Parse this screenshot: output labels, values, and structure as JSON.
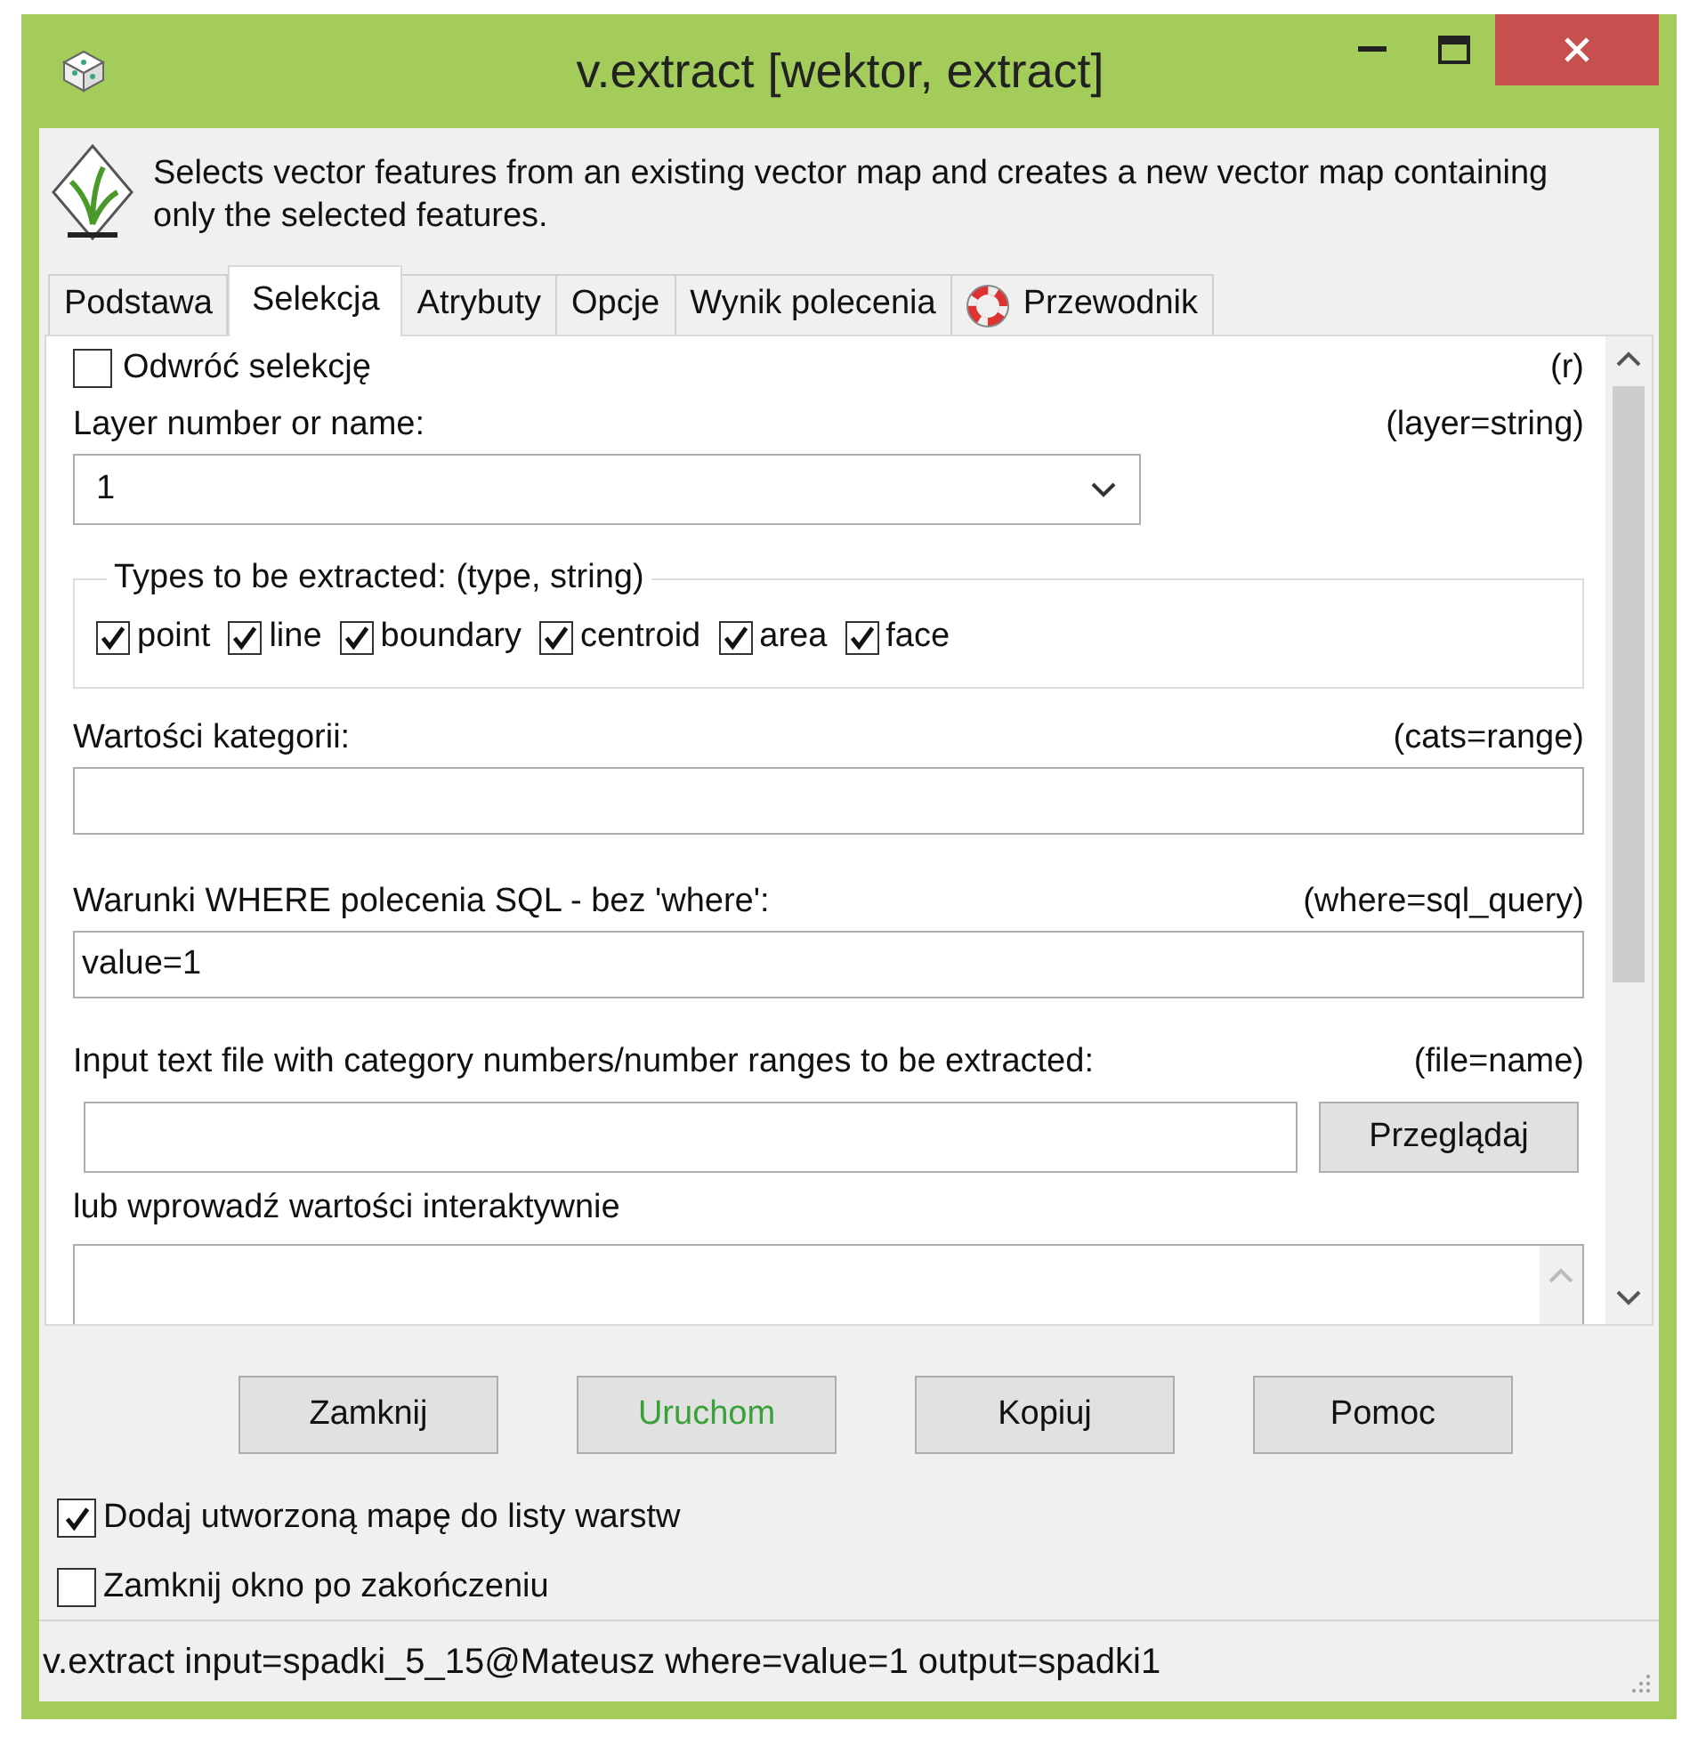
{
  "window": {
    "title": "v.extract [wektor, extract]"
  },
  "description": "Selects vector features from an existing vector map and creates a new vector map containing only the selected features.",
  "tabs": [
    {
      "label": "Podstawa",
      "selected": false,
      "kind": "plain"
    },
    {
      "label": "Selekcja",
      "selected": true,
      "kind": "plain"
    },
    {
      "label": "Atrybuty",
      "selected": false,
      "kind": "plain"
    },
    {
      "label": "Opcje",
      "selected": false,
      "kind": "plain"
    },
    {
      "label": "Wynik polecenia",
      "selected": false,
      "kind": "plain"
    },
    {
      "label": "Przewodnik",
      "selected": false,
      "kind": "help"
    }
  ],
  "panel": {
    "items": [
      {
        "kind": "checkbox",
        "label": "Odwróć selekcję",
        "param": "(r)",
        "checked": false
      },
      {
        "kind": "combo",
        "label": "Layer number or name:",
        "param": "(layer=string)",
        "value": "1"
      },
      {
        "kind": "group",
        "label": "Types to be extracted: (type, string)",
        "options": [
          {
            "label": "point",
            "checked": true
          },
          {
            "label": "line",
            "checked": true
          },
          {
            "label": "boundary",
            "checked": true
          },
          {
            "label": "centroid",
            "checked": true
          },
          {
            "label": "area",
            "checked": true
          },
          {
            "label": "face",
            "checked": true
          }
        ]
      },
      {
        "kind": "text",
        "label": "Wartości kategorii:",
        "param": "(cats=range)"
      },
      {
        "kind": "text",
        "label": "Warunki WHERE polecenia SQL - bez 'where':",
        "param": "(where=sql_query)",
        "value": "value=1"
      },
      {
        "kind": "file",
        "label": "Input text file with category numbers/number ranges to be extracted:",
        "param": "(file=name)",
        "button": "Przeglądaj"
      },
      {
        "kind": "textarea",
        "label": "lub wprowadź wartości interaktywnie"
      }
    ]
  },
  "buttons": [
    {
      "label": "Zamknij",
      "highlighted": false
    },
    {
      "label": "Uruchom",
      "highlighted": true
    },
    {
      "label": "Kopiuj",
      "highlighted": false
    },
    {
      "label": "Pomoc",
      "highlighted": false
    }
  ],
  "options": [
    {
      "label": "Dodaj utworzoną mapę do listy warstw",
      "checked": true
    },
    {
      "label": "Zamknij okno po zakończeniu",
      "checked": false
    }
  ],
  "status_bar": "v.extract input=spadki_5_15@Mateusz where=value=1 output=spadki1"
}
